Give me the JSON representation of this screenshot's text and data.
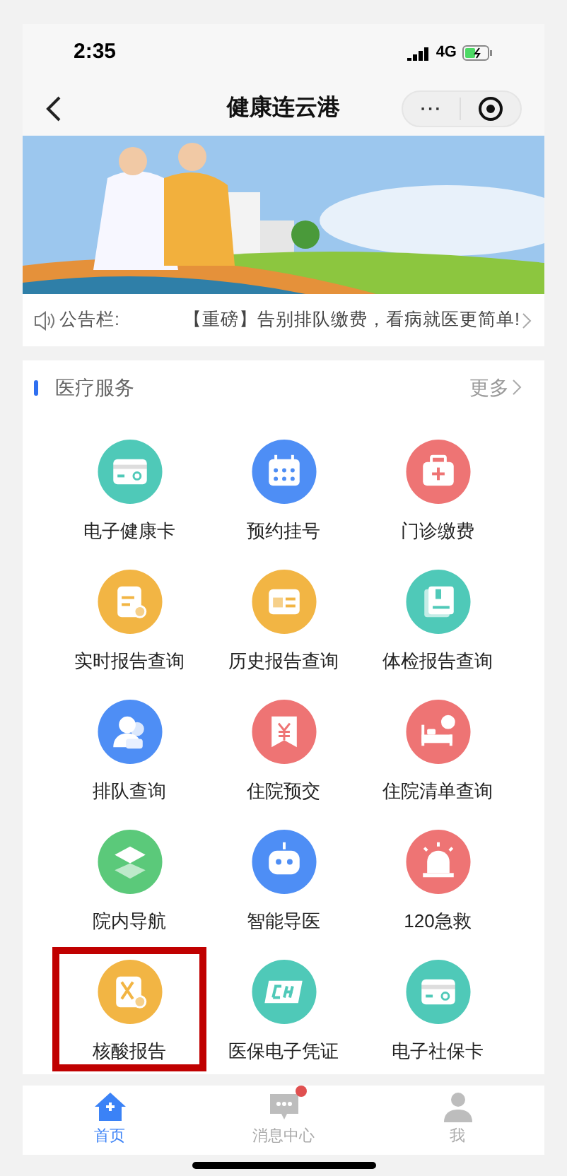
{
  "status_bar": {
    "time": "2:35",
    "network": "4G"
  },
  "nav": {
    "title": "健康连云港",
    "more": "···"
  },
  "notice": {
    "label": "公告栏:",
    "text": "【重磅】告别排队缴费，看病就医更简单!"
  },
  "services": {
    "title": "医疗服务",
    "more": "更多",
    "items": [
      {
        "label": "电子健康卡",
        "kind": "card",
        "color": "#4fc9b8",
        "highlighted": false
      },
      {
        "label": "预约挂号",
        "kind": "calendar",
        "color": "#4e8ef5",
        "highlighted": false
      },
      {
        "label": "门诊缴费",
        "kind": "kit",
        "color": "#ee7474",
        "highlighted": false
      },
      {
        "label": "实时报告查询",
        "kind": "report",
        "color": "#f2b544",
        "highlighted": false
      },
      {
        "label": "历史报告查询",
        "kind": "news",
        "color": "#f2b544",
        "highlighted": false
      },
      {
        "label": "体检报告查询",
        "kind": "book",
        "color": "#4fc9b8",
        "highlighted": false
      },
      {
        "label": "排队查询",
        "kind": "person",
        "color": "#4e8ef5",
        "highlighted": false
      },
      {
        "label": "住院预交",
        "kind": "yen",
        "color": "#ee7474",
        "highlighted": false
      },
      {
        "label": "住院清单查询",
        "kind": "bed",
        "color": "#ee7474",
        "highlighted": false
      },
      {
        "label": "院内导航",
        "kind": "layers",
        "color": "#5bc97a",
        "highlighted": false
      },
      {
        "label": "智能导医",
        "kind": "robot",
        "color": "#4e8ef5",
        "highlighted": false
      },
      {
        "label": "120急救",
        "kind": "siren",
        "color": "#ee7474",
        "highlighted": false
      },
      {
        "label": "核酸报告",
        "kind": "dna",
        "color": "#f2b544",
        "highlighted": true
      },
      {
        "label": "医保电子凭证",
        "kind": "chs",
        "color": "#4fc9b8",
        "highlighted": false
      },
      {
        "label": "电子社保卡",
        "kind": "card",
        "color": "#4fc9b8",
        "highlighted": false
      }
    ]
  },
  "tabs": [
    {
      "label": "首页",
      "kind": "home",
      "selected": true,
      "badge": false
    },
    {
      "label": "消息中心",
      "kind": "chat",
      "selected": false,
      "badge": true
    },
    {
      "label": "我",
      "kind": "user",
      "selected": false,
      "badge": false
    }
  ]
}
